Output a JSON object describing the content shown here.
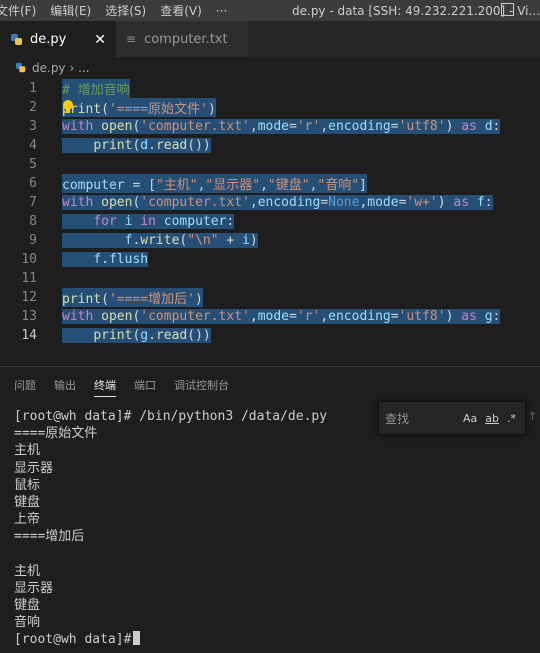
{
  "titlebar": {
    "menus": [
      "文件(F)",
      "编辑(E)",
      "选择(S)",
      "查看(V)",
      "···"
    ],
    "title": "de.py - data [SSH: 49.232.221.200] - Vi..."
  },
  "tabs": [
    {
      "label": "de.py",
      "close": "✕"
    },
    {
      "label": "computer.txt"
    }
  ],
  "breadcrumb": {
    "file": "de.py",
    "sep": "› ..."
  },
  "editor": {
    "line_numbers": [
      "1",
      "2",
      "3",
      "4",
      "5",
      "6",
      "7",
      "8",
      "9",
      "10",
      "11",
      "12",
      "13",
      "14"
    ]
  },
  "panel": {
    "tabs": [
      "问题",
      "输出",
      "终端",
      "端口",
      "调试控制台"
    ],
    "active_tab": "终端",
    "find_placeholder": "查找",
    "find_options": [
      "Aa",
      "ab",
      ".*"
    ]
  },
  "terminal": {
    "lines": [
      "[root@wh data]# /bin/python3 /data/de.py",
      "====原始文件",
      "主机",
      "显示器",
      "鼠标",
      "键盘",
      "上帝",
      "====增加后",
      "",
      "主机",
      "显示器",
      "键盘",
      "音响"
    ],
    "prompt": "[root@wh data]#"
  }
}
